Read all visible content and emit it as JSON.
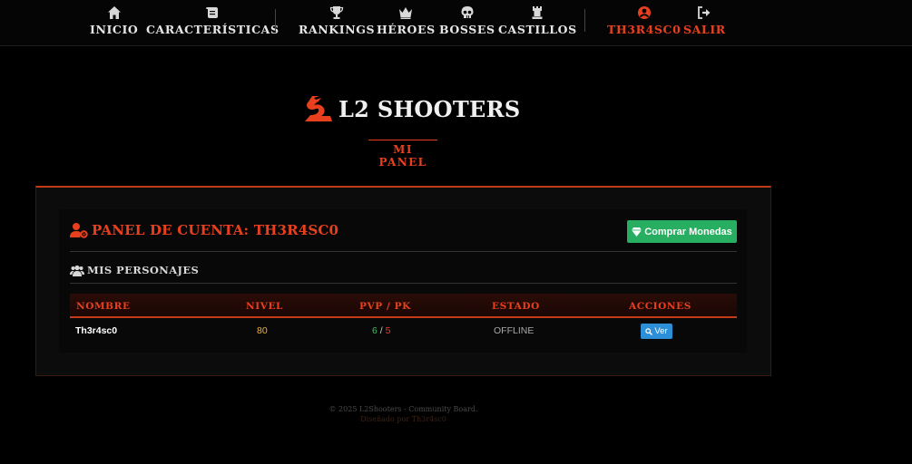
{
  "nav": {
    "items": [
      {
        "label": "INICIO",
        "icon": "home-icon"
      },
      {
        "label": "CARACTERÍSTICAS",
        "icon": "scroll-icon"
      },
      {
        "label": "RANKINGS",
        "icon": "trophy-icon"
      },
      {
        "label": "HÉROES",
        "icon": "crown-icon"
      },
      {
        "label": "BOSSES",
        "icon": "skull-icon"
      },
      {
        "label": "CASTILLOS",
        "icon": "castle-icon"
      }
    ],
    "user": {
      "label": "TH3R4SC0",
      "icon": "user-circle-icon"
    },
    "logout": {
      "label": "SALIR",
      "icon": "sign-out-icon"
    }
  },
  "hero": {
    "logo_text": "L2 SHOOTERS",
    "subtitle": "MI PANEL"
  },
  "panel": {
    "title": "PANEL DE CUENTA: TH3R4SC0",
    "buy_button": "Comprar Monedas",
    "section_title": "MIS PERSONAJES",
    "table": {
      "headers": [
        "NOMBRE",
        "NIVEL",
        "PVP / PK",
        "ESTADO",
        "ACCIONES"
      ],
      "rows": [
        {
          "name": "Th3r4sc0",
          "level": "80",
          "pvp": "6",
          "pk": "5",
          "status": "OFFLINE",
          "action": "Ver"
        }
      ]
    }
  },
  "footer": {
    "copyright": "© 2025 L2Shooters - Community Board.",
    "designed": "Diseñado por Th3r4sc0"
  },
  "colors": {
    "accent": "#e8401e",
    "green": "#27ae60",
    "blue": "#2d8fd8"
  }
}
